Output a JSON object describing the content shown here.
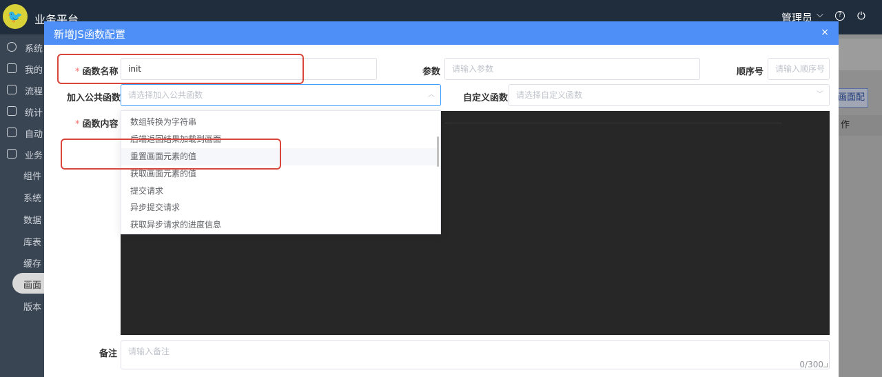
{
  "app": {
    "title": "业务平台",
    "user": "管理员",
    "help_glyph": "?",
    "sidebar": [
      {
        "label": "系统"
      },
      {
        "label": "我的"
      },
      {
        "label": "流程"
      },
      {
        "label": "统计"
      },
      {
        "label": "自动"
      },
      {
        "label": "业务"
      }
    ],
    "sidebar_sub": [
      {
        "label": "组件"
      },
      {
        "label": "系统"
      },
      {
        "label": "数据"
      },
      {
        "label": "库表"
      },
      {
        "label": "缓存"
      },
      {
        "label": "版本"
      }
    ],
    "sidebar_active": "画面",
    "right_button": "画面配置",
    "right_ops": "作"
  },
  "dialog": {
    "title": "新增JS函数配置",
    "close_glyph": "×",
    "fields": {
      "func_name": {
        "label": "函数名称",
        "required_mark": "*",
        "value": "init"
      },
      "params": {
        "label": "参数",
        "placeholder": "请输入参数"
      },
      "order": {
        "label": "顺序号",
        "placeholder": "请输入顺序号"
      },
      "public_func": {
        "label": "加入公共函数",
        "placeholder": "请选择加入公共函数"
      },
      "custom_func": {
        "label": "自定义函数",
        "placeholder": "请选择自定义函数"
      },
      "content": {
        "label": "函数内容",
        "required_mark": "*"
      },
      "remark": {
        "label": "备注",
        "placeholder": "请输入备注",
        "counter": "0/300"
      }
    },
    "dropdown": {
      "items": [
        {
          "label": "数组转换为字符串"
        },
        {
          "label": "后端返回结果加载到画面"
        },
        {
          "label": "重置画面元素的值"
        },
        {
          "label": "获取画面元素的值"
        },
        {
          "label": "提交请求"
        },
        {
          "label": "异步提交请求"
        },
        {
          "label": "获取异步请求的进度信息"
        }
      ]
    }
  },
  "colors": {
    "dialog_header": "#4e8ff7",
    "highlight": "#d9453b",
    "editor_bg": "#272727",
    "required": "#f56c6c"
  }
}
